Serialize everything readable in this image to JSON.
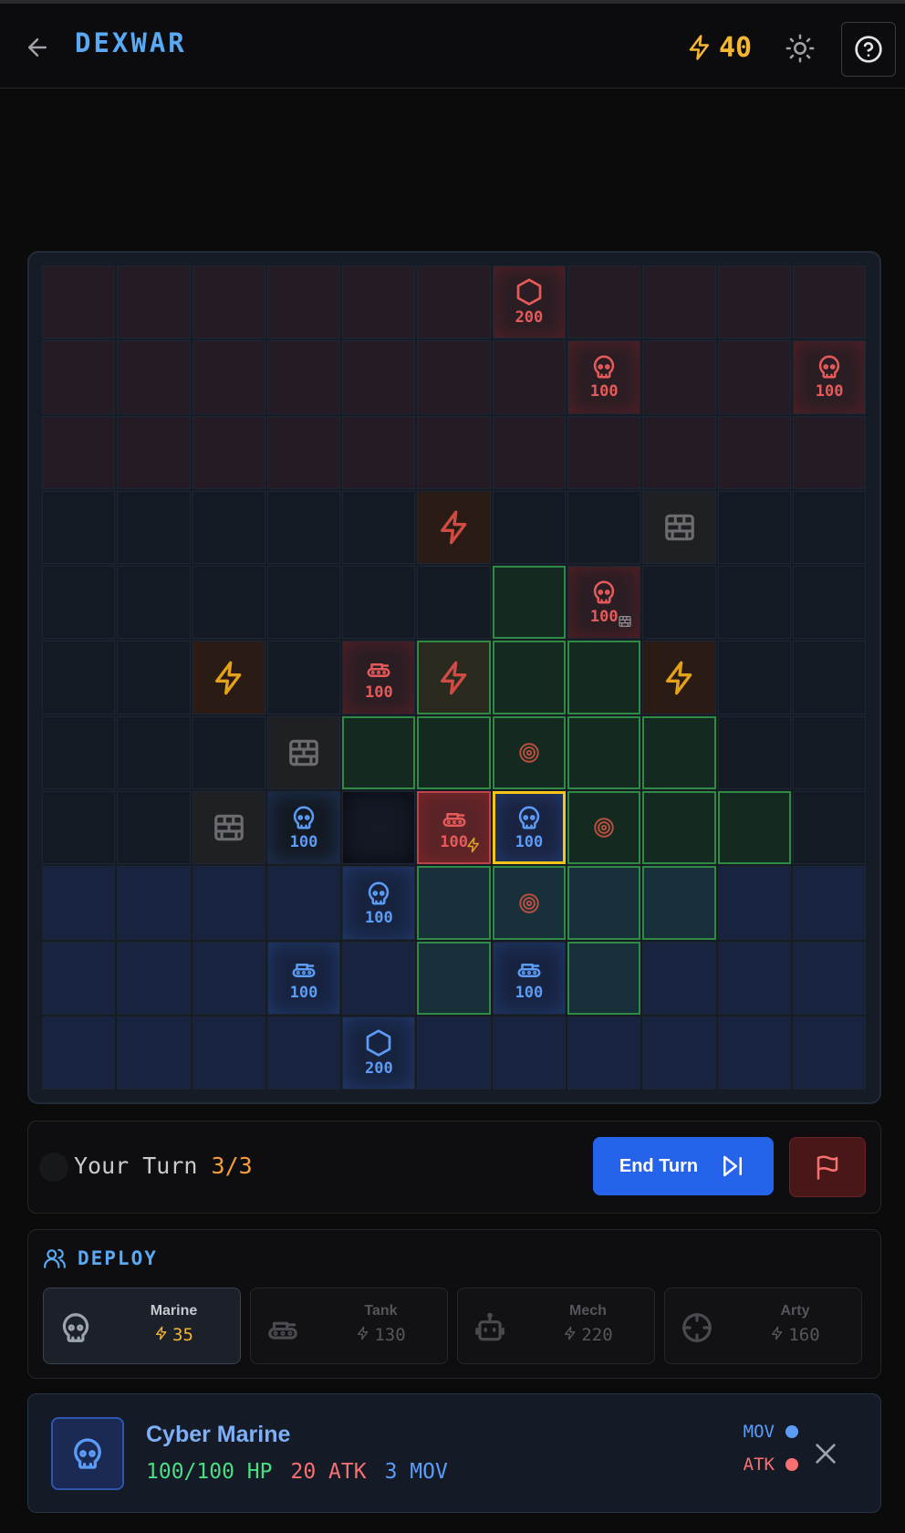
{
  "header": {
    "title": "DEXWAR",
    "energy": "40",
    "icons": {
      "back": "arrow-left-icon",
      "energy": "lightning-icon",
      "theme": "sun-icon",
      "help": "help-circle-icon"
    }
  },
  "colors": {
    "accent_blue": "#5aa9f5",
    "energy_yellow": "#f5b731",
    "enemy_red": "#e65a5a",
    "player_blue": "#5b9cf6",
    "move_green": "#2f8a43",
    "select_yellow": "#f5c518",
    "end_turn_blue": "#2563eb"
  },
  "board": {
    "size": 11,
    "zones": [
      "enemy",
      "enemy",
      "enemy",
      "neutral",
      "neutral",
      "neutral",
      "neutral",
      "neutral",
      "player",
      "player",
      "player"
    ],
    "cells": [
      {
        "r": 0,
        "c": 6,
        "type": "base",
        "side": "enemy",
        "hp": "200"
      },
      {
        "r": 1,
        "c": 7,
        "type": "marine",
        "side": "enemy",
        "hp": "100"
      },
      {
        "r": 1,
        "c": 10,
        "type": "marine",
        "side": "enemy",
        "hp": "100"
      },
      {
        "r": 3,
        "c": 5,
        "type": "energy",
        "tint": "red"
      },
      {
        "r": 3,
        "c": 8,
        "type": "wall"
      },
      {
        "r": 4,
        "c": 6,
        "move": true
      },
      {
        "r": 4,
        "c": 7,
        "type": "marine",
        "side": "enemy",
        "hp": "100",
        "badge": "wall"
      },
      {
        "r": 5,
        "c": 2,
        "type": "energy",
        "tint": "yellow"
      },
      {
        "r": 5,
        "c": 4,
        "type": "tank",
        "side": "enemy",
        "hp": "100"
      },
      {
        "r": 5,
        "c": 5,
        "type": "energy",
        "tint": "red",
        "move": true
      },
      {
        "r": 5,
        "c": 6,
        "move": true
      },
      {
        "r": 5,
        "c": 7,
        "move": true
      },
      {
        "r": 5,
        "c": 8,
        "type": "energy",
        "tint": "yellow"
      },
      {
        "r": 6,
        "c": 3,
        "type": "wall"
      },
      {
        "r": 6,
        "c": 4,
        "move": true
      },
      {
        "r": 6,
        "c": 5,
        "move": true
      },
      {
        "r": 6,
        "c": 6,
        "move": true,
        "marker": "target"
      },
      {
        "r": 6,
        "c": 7,
        "move": true
      },
      {
        "r": 6,
        "c": 8,
        "move": true
      },
      {
        "r": 7,
        "c": 2,
        "type": "wall"
      },
      {
        "r": 7,
        "c": 3,
        "type": "marine",
        "side": "player",
        "hp": "100"
      },
      {
        "r": 7,
        "c": 4,
        "shadow": true
      },
      {
        "r": 7,
        "c": 5,
        "type": "tank",
        "side": "enemy",
        "hp": "100",
        "attackable": true,
        "badge": "energy"
      },
      {
        "r": 7,
        "c": 6,
        "type": "marine",
        "side": "player",
        "hp": "100",
        "selected": true
      },
      {
        "r": 7,
        "c": 7,
        "move": true,
        "marker": "target"
      },
      {
        "r": 7,
        "c": 8,
        "move": true
      },
      {
        "r": 7,
        "c": 9,
        "move": true
      },
      {
        "r": 8,
        "c": 4,
        "type": "marine",
        "side": "player",
        "hp": "100"
      },
      {
        "r": 8,
        "c": 5,
        "move": true
      },
      {
        "r": 8,
        "c": 6,
        "move": true,
        "marker": "target"
      },
      {
        "r": 8,
        "c": 7,
        "move": true
      },
      {
        "r": 8,
        "c": 8,
        "move": true
      },
      {
        "r": 9,
        "c": 3,
        "type": "tank",
        "side": "player",
        "hp": "100"
      },
      {
        "r": 9,
        "c": 5,
        "move": true
      },
      {
        "r": 9,
        "c": 6,
        "type": "tank",
        "side": "player",
        "hp": "100"
      },
      {
        "r": 9,
        "c": 7,
        "move": true
      },
      {
        "r": 10,
        "c": 4,
        "type": "base",
        "side": "player",
        "hp": "200"
      }
    ]
  },
  "turn": {
    "label": "Your Turn",
    "count": "3/3",
    "end_turn_label": "End Turn",
    "icons": {
      "end_turn": "skip-forward-icon",
      "surrender": "flag-icon"
    }
  },
  "deploy": {
    "title": "DEPLOY",
    "icon": "users-icon",
    "units": [
      {
        "name": "Marine",
        "cost": "35",
        "icon": "skull-icon",
        "active": true
      },
      {
        "name": "Tank",
        "cost": "130",
        "icon": "tank-icon",
        "active": false
      },
      {
        "name": "Mech",
        "cost": "220",
        "icon": "robot-icon",
        "active": false
      },
      {
        "name": "Arty",
        "cost": "160",
        "icon": "crosshair-icon",
        "active": false
      }
    ]
  },
  "selected_unit": {
    "name": "Cyber Marine",
    "hp": "100/100 HP",
    "atk": "20 ATK",
    "mov": "3 MOV",
    "legend_mov": "MOV",
    "legend_atk": "ATK",
    "icon": "skull-icon",
    "close_icon": "close-icon"
  }
}
